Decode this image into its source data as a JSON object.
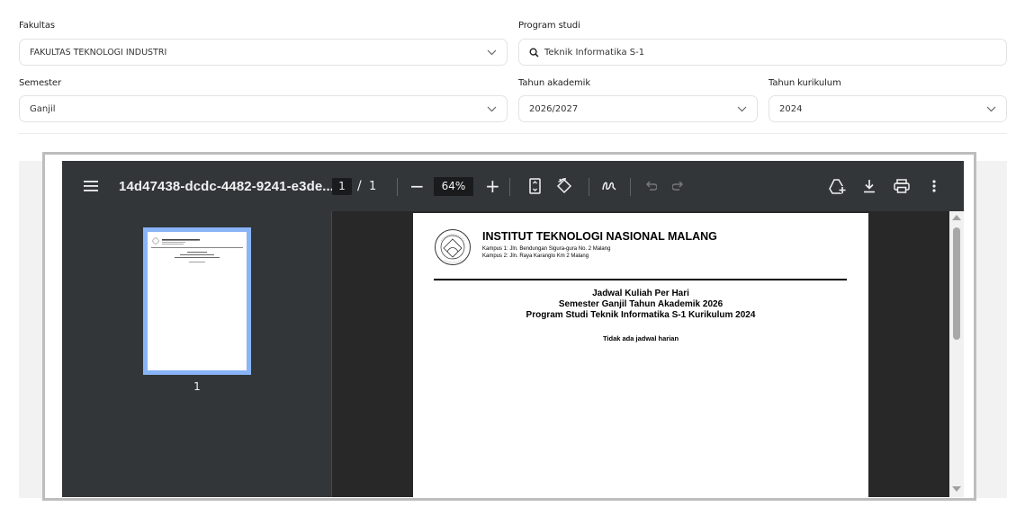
{
  "form": {
    "fakultas_label": "Fakultas",
    "fakultas_value": "FAKULTAS TEKNOLOGI INDUSTRI",
    "prodi_label": "Program studi",
    "prodi_value": "Teknik Informatika S-1",
    "semester_label": "Semester",
    "semester_value": "Ganjil",
    "tahun_akademik_label": "Tahun akademik",
    "tahun_akademik_value": "2026/2027",
    "tahun_kurikulum_label": "Tahun kurikulum",
    "tahun_kurikulum_value": "2024"
  },
  "viewer": {
    "filename": "14d47438-dcdc-4482-9241-e3de...",
    "current_page": "1",
    "page_separator": "/",
    "total_pages": "1",
    "zoom": "64%",
    "minus": "−",
    "plus": "+",
    "thumb_page_number": "1"
  },
  "document": {
    "institution": "INSTITUT TEKNOLOGI NASIONAL MALANG",
    "campus1": "Kampus 1: Jln. Bendungan Sigura-gura No. 2 Malang",
    "campus2": "Kampus 2: Jln. Raya Karanglo Km 2 Malang",
    "title1": "Jadwal Kuliah Per Hari",
    "title2": "Semester Ganjil Tahun Akademik 2026",
    "title3": "Program Studi Teknik Informatika S-1 Kurikulum 2024",
    "empty_notice": "Tidak ada jadwal harian"
  },
  "icons": {
    "menu": "menu-icon",
    "fit": "fit-page-icon",
    "rotate": "rotate-icon",
    "annotate": "annotate-icon",
    "undo": "undo-icon",
    "redo": "redo-icon",
    "save_drive": "add-to-drive-icon",
    "download": "download-icon",
    "print": "print-icon",
    "more": "more-vert-icon",
    "search": "search-icon",
    "chevron": "chevron-down-icon"
  }
}
